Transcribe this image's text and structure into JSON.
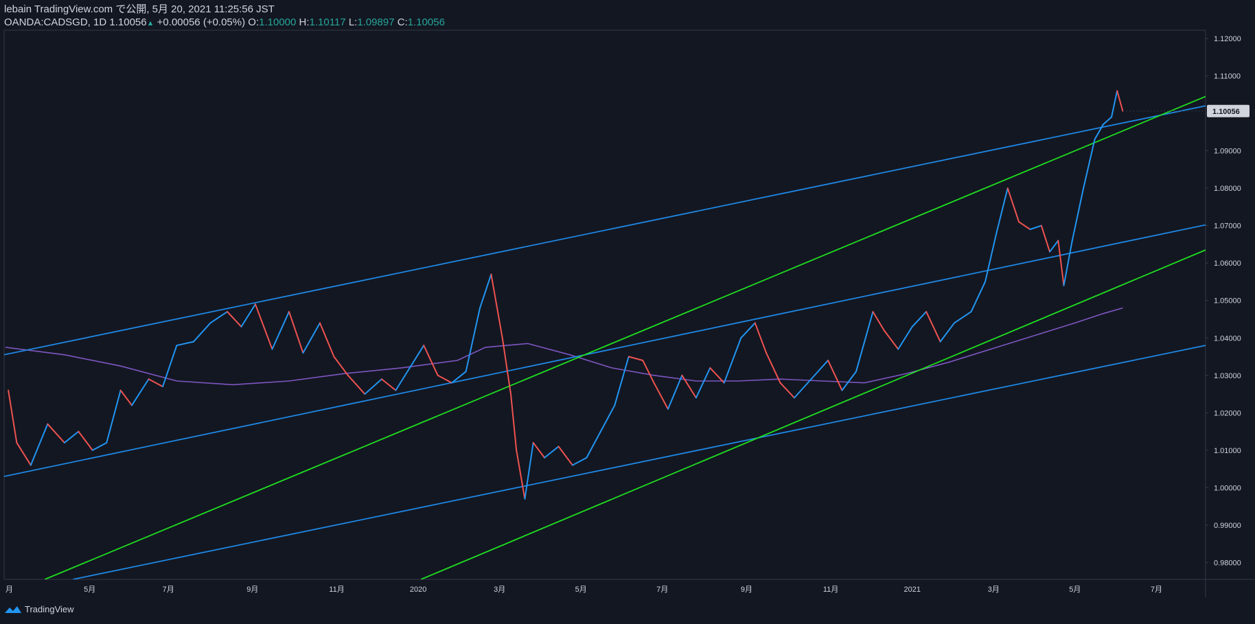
{
  "header": {
    "line1": "lebain TradingView.com で公開, 5月 20, 2021 11:25:56 JST",
    "symbol": "OANDA:CADSGD, 1D",
    "last": "1.10056",
    "change": "+0.00056 (+0.05%)",
    "o_label": "O:",
    "o_val": "1.10000",
    "h_label": "H:",
    "h_val": "1.10117",
    "l_label": "L:",
    "l_val": "1.09897",
    "c_label": "C:",
    "c_val": "1.10056"
  },
  "footer": {
    "brand": "TradingView"
  },
  "colors": {
    "background": "#131722",
    "up": "#2196f3",
    "down": "#ef5350",
    "blue_line": "#1e88e5",
    "green_line": "#1fe01f",
    "ma_line": "#7e57c2",
    "price_badge": "#d1d4dc"
  },
  "chart_data": {
    "type": "line",
    "symbol": "OANDA:CADSGD",
    "timeframe": "1D",
    "y_axis": {
      "ticks": [
        "1.12000",
        "1.11000",
        "1.10000",
        "1.09000",
        "1.08000",
        "1.07000",
        "1.06000",
        "1.05000",
        "1.04000",
        "1.03000",
        "1.02000",
        "1.01000",
        "1.00000",
        "0.99000",
        "0.98000"
      ],
      "tick_values": [
        1.12,
        1.11,
        1.1,
        1.09,
        1.08,
        1.07,
        1.06,
        1.05,
        1.04,
        1.03,
        1.02,
        1.01,
        1.0,
        0.99,
        0.98
      ],
      "range": [
        0.9755,
        1.1222
      ],
      "current_price_label": "1.10056"
    },
    "x_axis": {
      "labels": [
        "月",
        "5月",
        "7月",
        "9月",
        "11月",
        "2020",
        "3月",
        "5月",
        "7月",
        "9月",
        "11月",
        "2021",
        "3月",
        "5月",
        "7月"
      ],
      "label_t": [
        0,
        29,
        57,
        87,
        117,
        146,
        175,
        204,
        233,
        263,
        293,
        322,
        351,
        380,
        409
      ],
      "range_t": [
        -1.5,
        426.5
      ]
    },
    "price_points": [
      {
        "t": 0,
        "v": 1.026
      },
      {
        "t": 3,
        "v": 1.012
      },
      {
        "t": 8,
        "v": 1.006
      },
      {
        "t": 14,
        "v": 1.017
      },
      {
        "t": 20,
        "v": 1.012
      },
      {
        "t": 25,
        "v": 1.015
      },
      {
        "t": 30,
        "v": 1.01
      },
      {
        "t": 35,
        "v": 1.012
      },
      {
        "t": 40,
        "v": 1.026
      },
      {
        "t": 44,
        "v": 1.022
      },
      {
        "t": 50,
        "v": 1.029
      },
      {
        "t": 55,
        "v": 1.027
      },
      {
        "t": 60,
        "v": 1.038
      },
      {
        "t": 66,
        "v": 1.039
      },
      {
        "t": 72,
        "v": 1.044
      },
      {
        "t": 78,
        "v": 1.047
      },
      {
        "t": 83,
        "v": 1.043
      },
      {
        "t": 88,
        "v": 1.049
      },
      {
        "t": 94,
        "v": 1.037
      },
      {
        "t": 100,
        "v": 1.047
      },
      {
        "t": 105,
        "v": 1.036
      },
      {
        "t": 111,
        "v": 1.044
      },
      {
        "t": 116,
        "v": 1.035
      },
      {
        "t": 121,
        "v": 1.03
      },
      {
        "t": 127,
        "v": 1.025
      },
      {
        "t": 133,
        "v": 1.029
      },
      {
        "t": 138,
        "v": 1.026
      },
      {
        "t": 143,
        "v": 1.032
      },
      {
        "t": 148,
        "v": 1.038
      },
      {
        "t": 153,
        "v": 1.03
      },
      {
        "t": 158,
        "v": 1.028
      },
      {
        "t": 163,
        "v": 1.031
      },
      {
        "t": 168,
        "v": 1.048
      },
      {
        "t": 172,
        "v": 1.057
      },
      {
        "t": 176,
        "v": 1.04
      },
      {
        "t": 179,
        "v": 1.025
      },
      {
        "t": 181,
        "v": 1.01
      },
      {
        "t": 184,
        "v": 0.997
      },
      {
        "t": 187,
        "v": 1.012
      },
      {
        "t": 191,
        "v": 1.008
      },
      {
        "t": 196,
        "v": 1.011
      },
      {
        "t": 201,
        "v": 1.006
      },
      {
        "t": 206,
        "v": 1.008
      },
      {
        "t": 211,
        "v": 1.015
      },
      {
        "t": 216,
        "v": 1.022
      },
      {
        "t": 221,
        "v": 1.035
      },
      {
        "t": 226,
        "v": 1.034
      },
      {
        "t": 230,
        "v": 1.028
      },
      {
        "t": 235,
        "v": 1.021
      },
      {
        "t": 240,
        "v": 1.03
      },
      {
        "t": 245,
        "v": 1.024
      },
      {
        "t": 250,
        "v": 1.032
      },
      {
        "t": 255,
        "v": 1.028
      },
      {
        "t": 261,
        "v": 1.04
      },
      {
        "t": 266,
        "v": 1.044
      },
      {
        "t": 270,
        "v": 1.036
      },
      {
        "t": 275,
        "v": 1.028
      },
      {
        "t": 280,
        "v": 1.024
      },
      {
        "t": 286,
        "v": 1.029
      },
      {
        "t": 292,
        "v": 1.034
      },
      {
        "t": 297,
        "v": 1.026
      },
      {
        "t": 302,
        "v": 1.031
      },
      {
        "t": 308,
        "v": 1.047
      },
      {
        "t": 312,
        "v": 1.042
      },
      {
        "t": 317,
        "v": 1.037
      },
      {
        "t": 322,
        "v": 1.043
      },
      {
        "t": 327,
        "v": 1.047
      },
      {
        "t": 332,
        "v": 1.039
      },
      {
        "t": 337,
        "v": 1.044
      },
      {
        "t": 343,
        "v": 1.047
      },
      {
        "t": 348,
        "v": 1.055
      },
      {
        "t": 352,
        "v": 1.068
      },
      {
        "t": 356,
        "v": 1.08
      },
      {
        "t": 360,
        "v": 1.071
      },
      {
        "t": 364,
        "v": 1.069
      },
      {
        "t": 368,
        "v": 1.07
      },
      {
        "t": 371,
        "v": 1.063
      },
      {
        "t": 374,
        "v": 1.066
      },
      {
        "t": 376,
        "v": 1.054
      },
      {
        "t": 379,
        "v": 1.066
      },
      {
        "t": 383,
        "v": 1.08
      },
      {
        "t": 387,
        "v": 1.093
      },
      {
        "t": 390,
        "v": 1.097
      },
      {
        "t": 393,
        "v": 1.099
      },
      {
        "t": 395,
        "v": 1.106
      },
      {
        "t": 397,
        "v": 1.1006
      }
    ],
    "moving_average": [
      {
        "t": -1,
        "v": 1.0375
      },
      {
        "t": 20,
        "v": 1.0355
      },
      {
        "t": 40,
        "v": 1.0325
      },
      {
        "t": 60,
        "v": 1.0285
      },
      {
        "t": 80,
        "v": 1.0275
      },
      {
        "t": 100,
        "v": 1.0285
      },
      {
        "t": 120,
        "v": 1.0305
      },
      {
        "t": 140,
        "v": 1.032
      },
      {
        "t": 160,
        "v": 1.034
      },
      {
        "t": 170,
        "v": 1.0375
      },
      {
        "t": 185,
        "v": 1.0385
      },
      {
        "t": 200,
        "v": 1.0355
      },
      {
        "t": 215,
        "v": 1.032
      },
      {
        "t": 230,
        "v": 1.03
      },
      {
        "t": 245,
        "v": 1.0285
      },
      {
        "t": 260,
        "v": 1.0285
      },
      {
        "t": 275,
        "v": 1.029
      },
      {
        "t": 290,
        "v": 1.0285
      },
      {
        "t": 305,
        "v": 1.028
      },
      {
        "t": 320,
        "v": 1.0305
      },
      {
        "t": 335,
        "v": 1.0335
      },
      {
        "t": 350,
        "v": 1.037
      },
      {
        "t": 365,
        "v": 1.0405
      },
      {
        "t": 380,
        "v": 1.044
      },
      {
        "t": 390,
        "v": 1.0465
      },
      {
        "t": 397,
        "v": 1.048
      }
    ],
    "trendlines": [
      {
        "name": "channel-upper",
        "color": "blue",
        "points": [
          {
            "t": -1.5,
            "v": 1.0355
          },
          {
            "t": 426.5,
            "v": 1.102
          }
        ]
      },
      {
        "name": "channel-mid",
        "color": "blue",
        "points": [
          {
            "t": -1.5,
            "v": 1.003
          },
          {
            "t": 426.5,
            "v": 1.0702
          }
        ]
      },
      {
        "name": "channel-lower",
        "color": "blue",
        "points": [
          {
            "t": 23,
            "v": 0.9755
          },
          {
            "t": 426.5,
            "v": 1.038
          }
        ]
      },
      {
        "name": "green-upper",
        "color": "green",
        "points": [
          {
            "t": 13,
            "v": 0.9755
          },
          {
            "t": 426.5,
            "v": 1.1045
          }
        ]
      },
      {
        "name": "green-lower",
        "color": "green",
        "points": [
          {
            "t": 147,
            "v": 0.9755
          },
          {
            "t": 426.5,
            "v": 1.0635
          }
        ]
      }
    ]
  }
}
